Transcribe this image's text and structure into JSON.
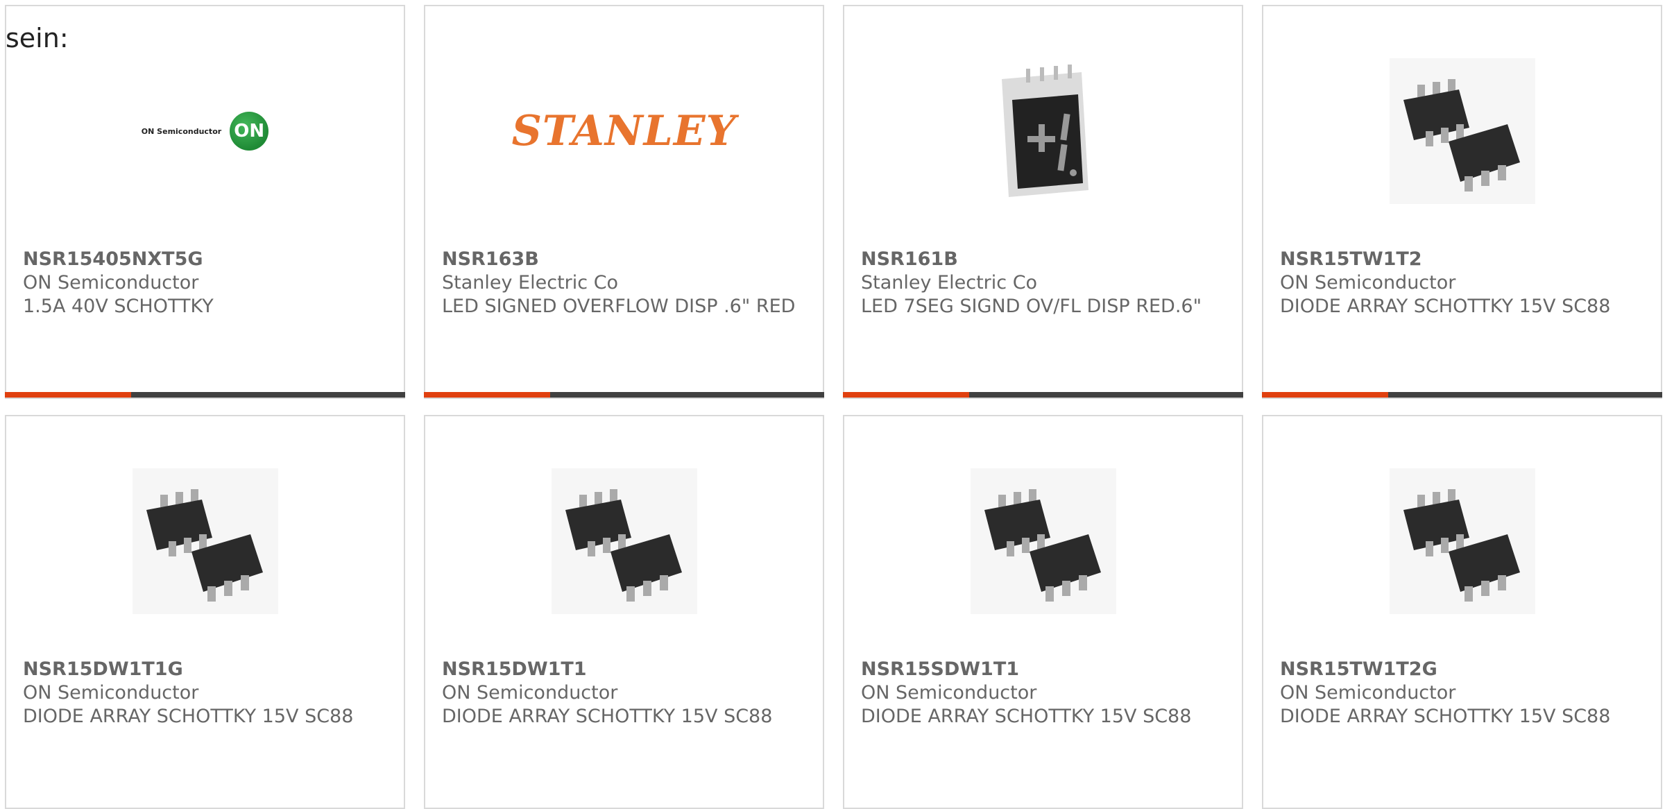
{
  "intro_text": "sein:",
  "colors": {
    "accent": "#e0400f",
    "bar": "#404040",
    "text": "#666666"
  },
  "products": [
    {
      "part": "NSR15405NXT5G",
      "maker": "ON Semiconductor",
      "desc": "1.5A 40V SCHOTTKY",
      "image": "on-semiconductor-logo",
      "logo_text": "ON Semiconductor",
      "logo_badge": "ON"
    },
    {
      "part": "NSR163B",
      "maker": "Stanley Electric Co",
      "desc": "LED SIGNED OVERFLOW DISP .6\" RED",
      "image": "stanley-logo",
      "logo_text": "STANLEY"
    },
    {
      "part": "NSR161B",
      "maker": "Stanley Electric Co",
      "desc": "LED 7SEG SIGND OV/FL DISP RED.6\"",
      "image": "seven-segment-display-photo"
    },
    {
      "part": "NSR15TW1T2",
      "maker": "ON Semiconductor",
      "desc": "DIODE ARRAY SCHOTTKY 15V SC88",
      "image": "sc88-chip-photo"
    },
    {
      "part": "NSR15DW1T1G",
      "maker": "ON Semiconductor",
      "desc": "DIODE ARRAY SCHOTTKY 15V SC88",
      "image": "sc88-chip-photo"
    },
    {
      "part": "NSR15DW1T1",
      "maker": "ON Semiconductor",
      "desc": "DIODE ARRAY SCHOTTKY 15V SC88",
      "image": "sc88-chip-photo"
    },
    {
      "part": "NSR15SDW1T1",
      "maker": "ON Semiconductor",
      "desc": "DIODE ARRAY SCHOTTKY 15V SC88",
      "image": "sc88-chip-photo"
    },
    {
      "part": "NSR15TW1T2G",
      "maker": "ON Semiconductor",
      "desc": "DIODE ARRAY SCHOTTKY 15V SC88",
      "image": "sc88-chip-photo"
    }
  ]
}
